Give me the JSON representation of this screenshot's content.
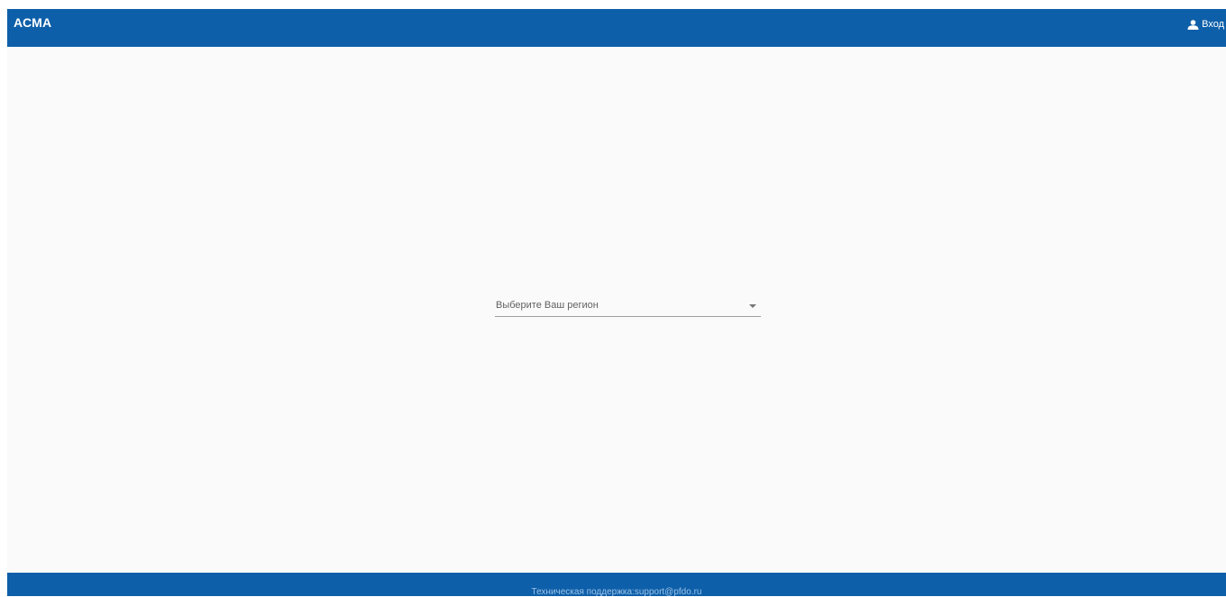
{
  "header": {
    "brand": "АСМА",
    "login_label": "Вход",
    "login_icon": "user-icon"
  },
  "main": {
    "region_select": {
      "placeholder": "Выберите Ваш регион",
      "icon": "chevron-down-icon"
    }
  },
  "footer": {
    "support_label": "Техническая поддержка:",
    "support_email": "support@pfdo.ru"
  },
  "colors": {
    "primary": "#0e5fa9",
    "background": "#fafafa",
    "footer_text": "#9cc3e8"
  }
}
